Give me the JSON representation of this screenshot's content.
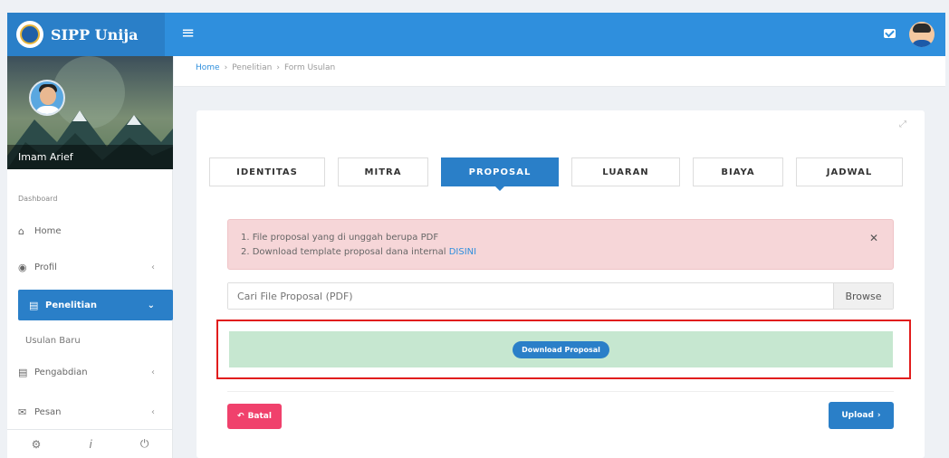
{
  "app": {
    "brand": "SIPP Unija"
  },
  "topbar": {
    "menu_icon": "hamburger-icon",
    "mail_icon": "envelope-icon"
  },
  "sidebar": {
    "user_name": "Imam Arief",
    "section": "Dashboard",
    "items": [
      {
        "label": "Home",
        "icon": "home-icon"
      },
      {
        "label": "Profil",
        "icon": "user-icon"
      },
      {
        "label": "Penelitian",
        "icon": "document-icon"
      },
      {
        "label": "Usulan Baru"
      },
      {
        "label": "Pengabdian",
        "icon": "document-icon"
      },
      {
        "label": "Pesan",
        "icon": "envelope-icon"
      }
    ],
    "footer": {
      "settings": "⚙",
      "info": "i",
      "power": "⏻"
    }
  },
  "breadcrumb": [
    "Home",
    "Penelitian",
    "Form Usulan"
  ],
  "tabs": [
    "IDENTITAS",
    "MITRA",
    "PROPOSAL",
    "LUARAN",
    "BIAYA",
    "JADWAL"
  ],
  "active_tab": "PROPOSAL",
  "alert": {
    "line1": "1. File proposal yang di unggah berupa PDF",
    "line2_prefix": "2. Download template proposal dana internal ",
    "line2_link": "DISINI"
  },
  "file": {
    "placeholder": "Cari File Proposal (PDF)",
    "browse_label": "Browse"
  },
  "download_button": "Download Proposal",
  "actions": {
    "cancel_label": "Batal",
    "upload_label": "Upload"
  },
  "colors": {
    "primary": "#2a7fc8",
    "danger": "#f0416c",
    "success_bg": "#c6e7d0",
    "alert_bg": "#f6d6d8",
    "highlight": "#e11d1d"
  }
}
